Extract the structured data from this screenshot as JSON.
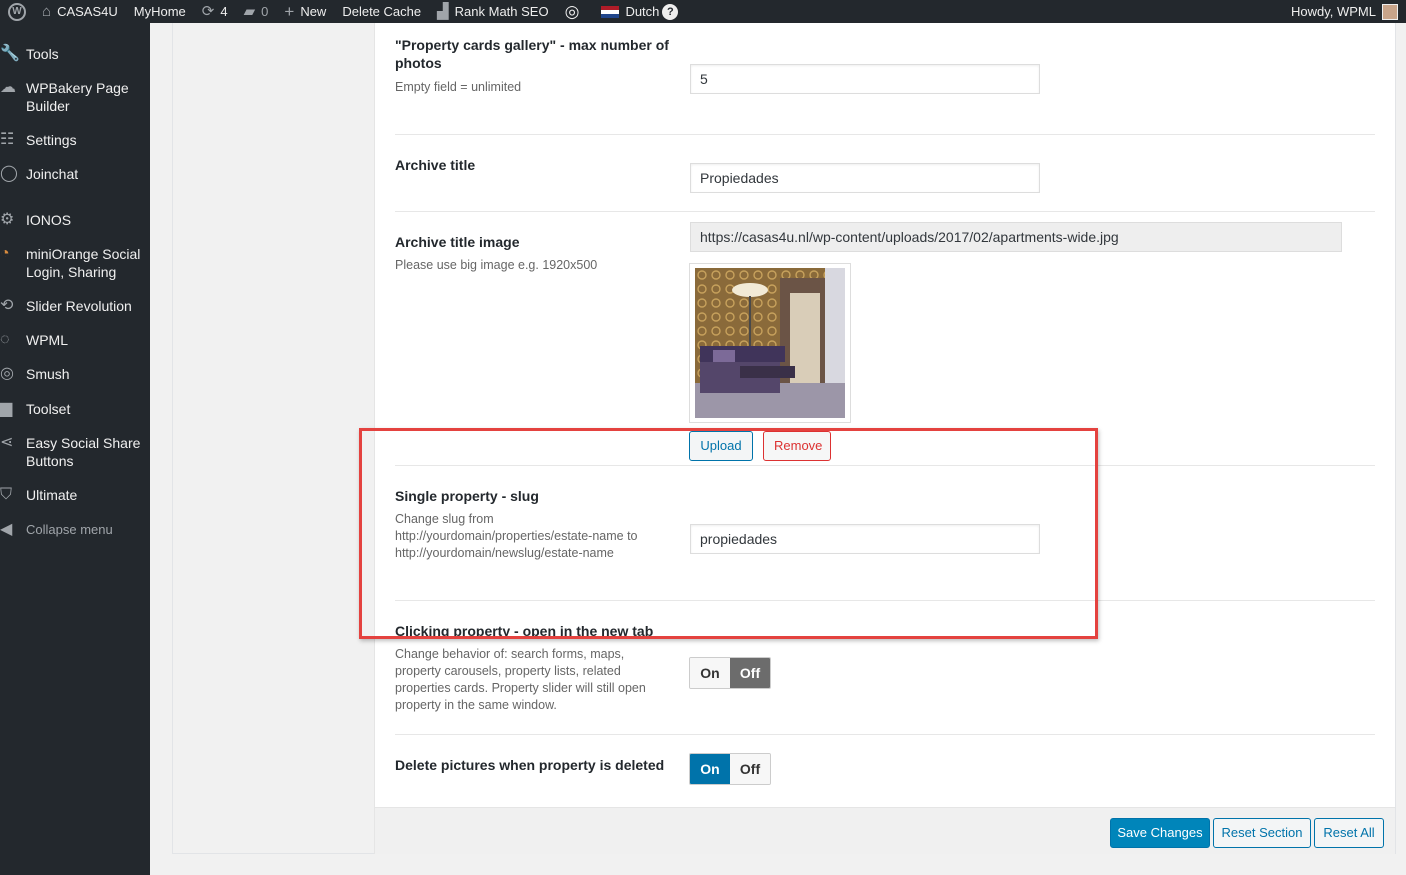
{
  "adminbar": {
    "site_name": "CASAS4U",
    "myhome": "MyHome",
    "updates_count": "4",
    "comments_count": "0",
    "new_label": "New",
    "delete_cache": "Delete Cache",
    "rank_math": "Rank Math SEO",
    "language": "Dutch",
    "help": "?",
    "howdy": "Howdy, WPML"
  },
  "sidebar": {
    "items": [
      {
        "label": "Tools",
        "icon": "wrench-icon"
      },
      {
        "label": "WPBakery Page Builder",
        "icon": "cloud-icon"
      },
      {
        "label": "Settings",
        "icon": "sliders-icon"
      },
      {
        "label": "Joinchat",
        "icon": "whatsapp-icon"
      },
      {
        "label": "IONOS",
        "icon": "gear-icon"
      },
      {
        "label": "miniOrange Social Login, Sharing",
        "icon": "miniorange-icon"
      },
      {
        "label": "Slider Revolution",
        "icon": "refresh-icon"
      },
      {
        "label": "WPML",
        "icon": "wpml-icon"
      },
      {
        "label": "Smush",
        "icon": "smush-icon"
      },
      {
        "label": "Toolset",
        "icon": "toolset-icon"
      },
      {
        "label": "Easy Social Share Buttons",
        "icon": "share-icon"
      },
      {
        "label": "Ultimate",
        "icon": "shield-icon"
      }
    ],
    "collapse_label": "Collapse menu"
  },
  "fields": {
    "gallery_max": {
      "title": "\"Property cards gallery\" - max number of photos",
      "desc": "Empty field = unlimited",
      "value": "5"
    },
    "archive_title": {
      "title": "Archive title",
      "value": "Propiedades"
    },
    "archive_title_image": {
      "title": "Archive title image",
      "desc": "Please use big image e.g. 1920x500",
      "value": "https://casas4u.nl/wp-content/uploads/2017/02/apartments-wide.jpg",
      "upload_label": "Upload",
      "remove_label": "Remove"
    },
    "single_slug": {
      "title": "Single property - slug",
      "desc": "Change slug from http://yourdomain/properties/estate-name to http://yourdomain/newslug/estate-name",
      "value": "propiedades"
    },
    "new_tab": {
      "title": "Clicking property - open in the new tab",
      "desc": "Change behavior of: search forms, maps, property carousels, property lists, related properties cards. Property slider will still open property in the same window.",
      "on_label": "On",
      "off_label": "Off",
      "state": "off"
    },
    "delete_pictures": {
      "title": "Delete pictures when property is deleted",
      "on_label": "On",
      "off_label": "Off",
      "state": "on"
    }
  },
  "footer": {
    "save": "Save Changes",
    "reset_section": "Reset Section",
    "reset_all": "Reset All"
  },
  "colors": {
    "primary": "#0085ba",
    "admin_dark": "#23282d",
    "danger": "#dc3232",
    "highlight": "#e4423f"
  }
}
